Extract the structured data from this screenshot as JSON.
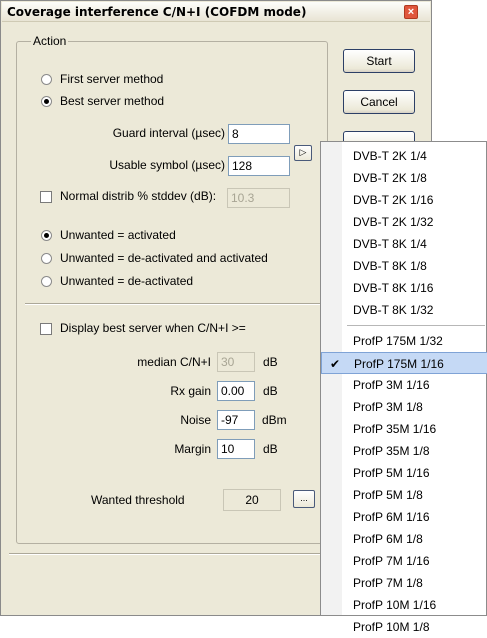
{
  "window": {
    "title": "Coverage interference C/N+I (COFDM mode)",
    "close_glyph": "×"
  },
  "action_group": {
    "label": "Action"
  },
  "method": {
    "options": [
      "First server method",
      "Best server method"
    ],
    "selected": 1
  },
  "guard_interval": {
    "label": "Guard interval (µsec)",
    "value": "8",
    "browse_label": "▷"
  },
  "usable_symbol": {
    "label": "Usable symbol (µsec)",
    "value": "128"
  },
  "normal_distrib": {
    "label": "Normal distrib % stddev (dB):",
    "value": "10.3",
    "checked": false
  },
  "unwanted": {
    "options": [
      "Unwanted = activated",
      "Unwanted = de-activated and activated",
      "Unwanted = de-activated"
    ],
    "selected": 0
  },
  "best_server": {
    "label": "Display best server when C/N+I >=",
    "checked": false
  },
  "params": {
    "median": {
      "label": "median C/N+I",
      "value": "30",
      "unit": "dB"
    },
    "rx_gain": {
      "label": "Rx gain",
      "value": "0.00",
      "unit": "dB"
    },
    "noise": {
      "label": "Noise",
      "value": "-97",
      "unit": "dBm"
    },
    "margin": {
      "label": "Margin",
      "value": "10",
      "unit": "dB"
    }
  },
  "wanted_threshold": {
    "label": "Wanted threshold",
    "value": "20",
    "button_label": "..."
  },
  "buttons": {
    "start": "Start",
    "cancel": "Cancel"
  },
  "menu": {
    "group1": [
      "DVB-T 2K 1/4",
      "DVB-T 2K 1/8",
      "DVB-T 2K 1/16",
      "DVB-T 2K 1/32",
      "DVB-T 8K 1/4",
      "DVB-T 8K 1/8",
      "DVB-T 8K 1/16",
      "DVB-T 8K 1/32"
    ],
    "group2": [
      "ProfP 175M 1/32",
      "ProfP 175M 1/16",
      "ProfP 3M 1/16",
      "ProfP 3M 1/8",
      "ProfP 35M 1/16",
      "ProfP 35M 1/8",
      "ProfP 5M 1/16",
      "ProfP 5M 1/8",
      "ProfP 6M 1/16",
      "ProfP 6M 1/8",
      "ProfP 7M 1/16",
      "ProfP 7M 1/8",
      "ProfP 10M 1/16",
      "ProfP 10M 1/8"
    ],
    "selected_item": "ProfP 175M 1/16",
    "check_glyph": "✔"
  },
  "colors": {
    "dialog_bg": "#ece9d8",
    "menu_highlight": "#c5d9f5",
    "close_button": "#e0563c"
  }
}
